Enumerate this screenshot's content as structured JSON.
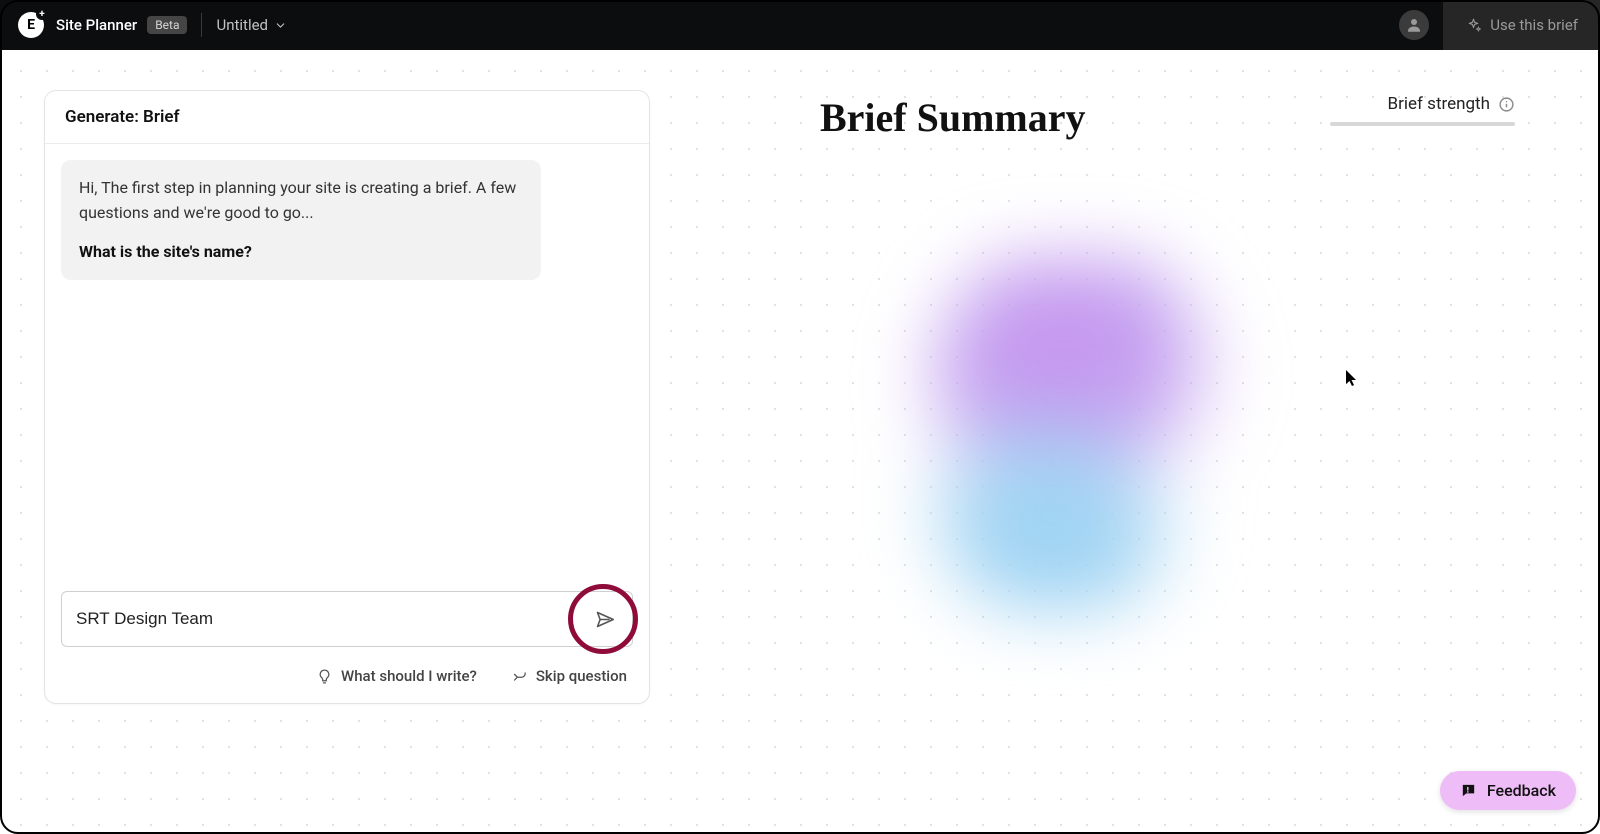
{
  "header": {
    "app_title": "Site Planner",
    "beta_label": "Beta",
    "doc_title": "Untitled",
    "use_brief_label": "Use this brief"
  },
  "chat": {
    "panel_title": "Generate: Brief",
    "message_intro": "Hi, The first step in planning your site is creating a brief. A few questions and we're good to go...",
    "message_question": "What is the site's name?",
    "input_value": "SRT Design Team",
    "input_placeholder": "",
    "helper_suggest": "What should I write?",
    "helper_skip": "Skip question"
  },
  "summary": {
    "heading": "Brief Summary",
    "strength_label": "Brief strength"
  },
  "feedback": {
    "label": "Feedback"
  },
  "icons": {
    "logo_letter": "E"
  }
}
